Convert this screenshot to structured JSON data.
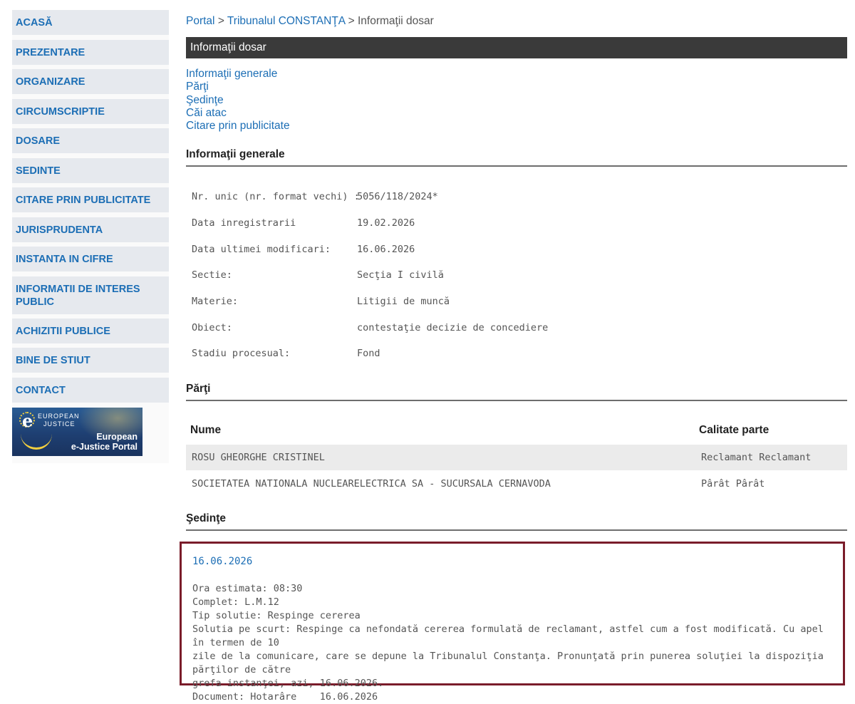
{
  "sidebar": {
    "items": [
      {
        "label": "ACASĂ"
      },
      {
        "label": "PREZENTARE"
      },
      {
        "label": "ORGANIZARE"
      },
      {
        "label": "CIRCUMSCRIPTIE"
      },
      {
        "label": "DOSARE"
      },
      {
        "label": "SEDINTE"
      },
      {
        "label": "CITARE PRIN PUBLICITATE"
      },
      {
        "label": "JURISPRUDENTA"
      },
      {
        "label": "INSTANTA IN CIFRE"
      },
      {
        "label": "INFORMATII DE INTERES PUBLIC"
      },
      {
        "label": "ACHIZITII PUBLICE"
      },
      {
        "label": "BINE DE STIUT"
      },
      {
        "label": "CONTACT"
      }
    ],
    "banner": {
      "small_line1": "EUROPEAN",
      "small_line2": "JUSTICE",
      "big_line1": "European",
      "big_line2": "e-Justice Portal"
    }
  },
  "breadcrumb": {
    "items": [
      "Portal",
      "Tribunalul CONSTANŢA",
      "Informaţii dosar"
    ],
    "separator": ">"
  },
  "page_title": "Informaţii dosar",
  "anchors": [
    "Informaţii generale",
    "Părţi",
    "Şedinţe",
    "Căi atac",
    "Citare prin publicitate"
  ],
  "sections": {
    "general_title": "Informaţii generale",
    "parti_title": "Părţi",
    "sedinte_title": "Şedinţe"
  },
  "general_info": [
    {
      "label": "Nr. unic (nr. format vechi) :",
      "value": "5056/118/2024*"
    },
    {
      "label": "Data inregistrarii",
      "value": "19.02.2026"
    },
    {
      "label": "Data ultimei modificari:",
      "value": "16.06.2026"
    },
    {
      "label": "Sectie:",
      "value": "Secţia I civilă"
    },
    {
      "label": "Materie:",
      "value": "Litigii de muncă"
    },
    {
      "label": "Obiect:",
      "value": "contestaţie decizie de concediere"
    },
    {
      "label": "Stadiu procesual:",
      "value": "Fond"
    }
  ],
  "parties": {
    "headers": {
      "name": "Nume",
      "role": "Calitate parte"
    },
    "rows": [
      {
        "name": "ROSU GHEORGHE CRISTINEL",
        "role": "Reclamant Reclamant"
      },
      {
        "name": "SOCIETATEA NATIONALA NUCLEARELECTRICA SA - SUCURSALA CERNAVODA",
        "role": "Pârât Pârât"
      }
    ]
  },
  "sedinta": {
    "date": "16.06.2026",
    "lines": [
      "Ora estimata: 08:30",
      "Complet: L.M.12",
      "Tip solutie: Respinge cererea",
      "Solutia pe scurt: Respinge ca nefondată cererea formulată de reclamant, astfel cum a fost modificată. Cu apel în termen de 10",
      "zile de la comunicare, care se depune la Tribunalul Constanţa. Pronunţată prin punerea soluţiei la dispoziţia părţilor de către",
      "grefa instanţei, azi, 16.06.2026.",
      "Document: Hotarâre    16.06.2026"
    ]
  },
  "colors": {
    "link": "#1c6eb5",
    "nav_bg": "#e6e9ee",
    "title_bar": "#3a3a3a",
    "highlight_border": "#7a1c2a",
    "row_alt": "#ebebeb"
  }
}
